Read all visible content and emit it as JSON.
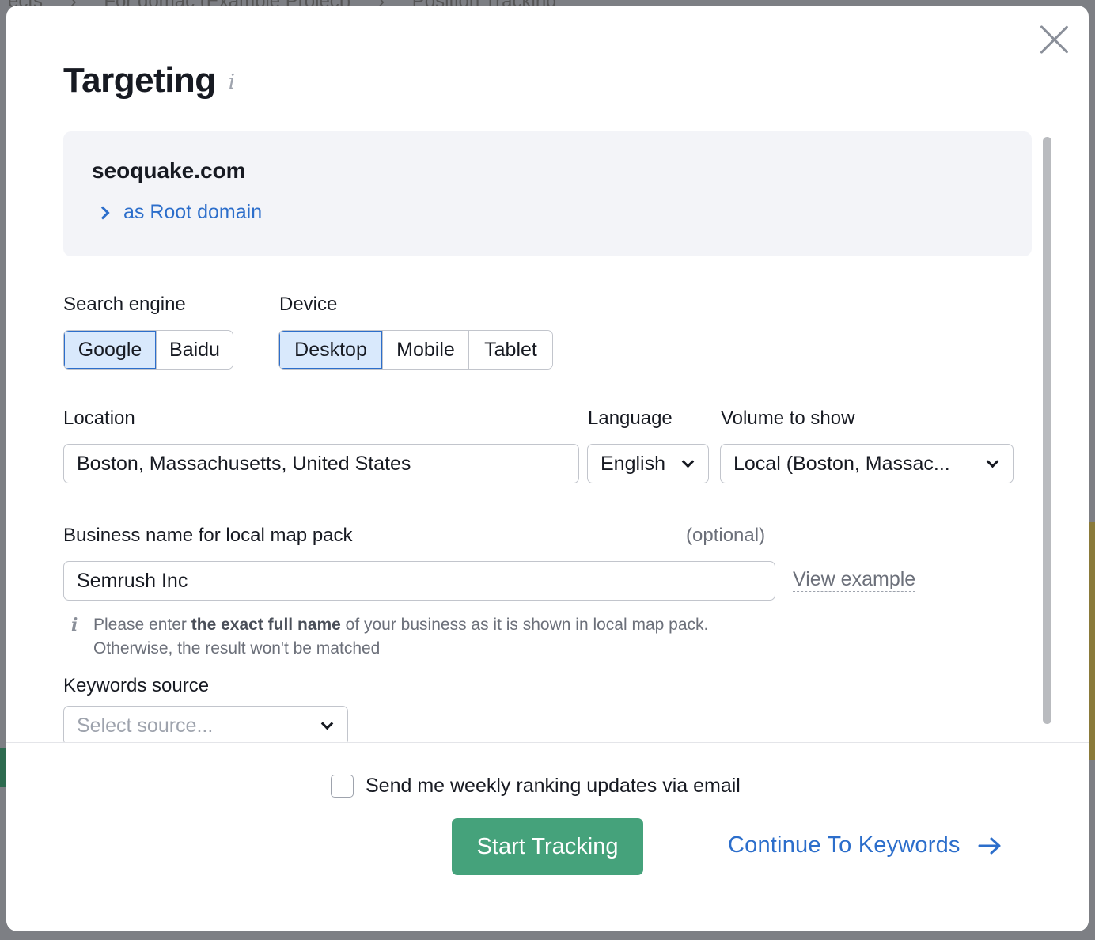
{
  "backdrop": {
    "breadcrumbs": [
      "ects",
      "For domac (Example Project)",
      "Position Tracking"
    ]
  },
  "modal": {
    "title": "Targeting",
    "title_info_icon": "info-icon",
    "close_icon": "close-icon",
    "domain": {
      "name": "seoquake.com",
      "scope_link": "as Root domain"
    },
    "search_engine": {
      "label": "Search engine",
      "options": [
        "Google",
        "Baidu"
      ],
      "selected": "Google"
    },
    "device": {
      "label": "Device",
      "options": [
        "Desktop",
        "Mobile",
        "Tablet"
      ],
      "selected": "Desktop"
    },
    "location": {
      "label": "Location",
      "value": "Boston, Massachusetts, United States"
    },
    "language": {
      "label": "Language",
      "value": "English"
    },
    "volume": {
      "label": "Volume to show",
      "value": "Local (Boston, Massac..."
    },
    "business": {
      "label": "Business name for local map pack",
      "optional_label": "(optional)",
      "value": "Semrush Inc",
      "view_example": "View example",
      "hint_prefix": "Please enter ",
      "hint_bold": "the exact full name",
      "hint_suffix": " of your business as it is shown in local map pack.",
      "hint_line2": "Otherwise, the result won't be matched"
    },
    "keywords_source": {
      "label": "Keywords source",
      "placeholder": "Select source..."
    },
    "footer": {
      "weekly_updates_label": "Send me weekly ranking updates via email",
      "weekly_updates_checked": false,
      "start_button": "Start Tracking",
      "continue_link": "Continue To Keywords"
    }
  },
  "colors": {
    "accent_blue": "#2c6ecb",
    "primary_green": "#45a27b",
    "selected_bg": "#d9e9fc"
  }
}
